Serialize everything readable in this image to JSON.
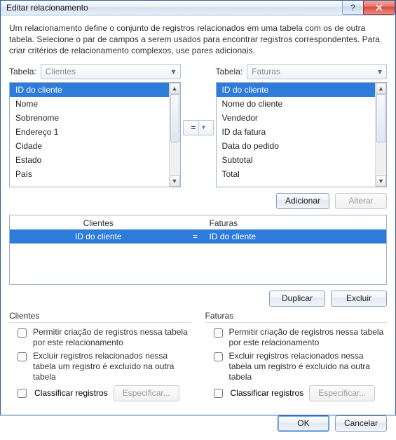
{
  "titlebar": {
    "title": "Editar relacionamento"
  },
  "description": "Um relacionamento define o conjunto de registros relacionados em uma tabela com os de outra tabela. Selecione o par de campos a serem usados para encontrar registros correspondentes. Para criar critérios de relacionamento complexos, use pares adicionais.",
  "left": {
    "label": "Tabela:",
    "selected": "Clientes",
    "fields": [
      "ID do cliente",
      "Nome",
      "Sobrenome",
      "Endereço 1",
      "Cidade",
      "Estado",
      "País"
    ]
  },
  "right": {
    "label": "Tabela:",
    "selected": "Faturas",
    "fields": [
      "ID do cliente",
      "Nome do cliente",
      "Vendedor",
      "ID da fatura",
      "Data do pedido",
      "Subtotal",
      "Total"
    ]
  },
  "operator": "=",
  "buttons": {
    "add": "Adicionar",
    "change": "Alterar",
    "duplicate": "Duplicar",
    "delete": "Excluir",
    "specify": "Especificar...",
    "ok": "OK",
    "cancel": "Cancelar"
  },
  "mapping": {
    "head_left": "Clientes",
    "head_right": "Faturas",
    "rows": [
      {
        "left": "ID do cliente",
        "op": "=",
        "right": "ID do cliente"
      }
    ]
  },
  "options": {
    "left_title": "Clientes",
    "right_title": "Faturas",
    "allow_create": "Permitir criação de registros nessa tabela por este relacionamento",
    "cascade_delete": "Excluir registros relacionados nessa tabela um registro é excluído na outra tabela",
    "sort": "Classificar registros"
  }
}
